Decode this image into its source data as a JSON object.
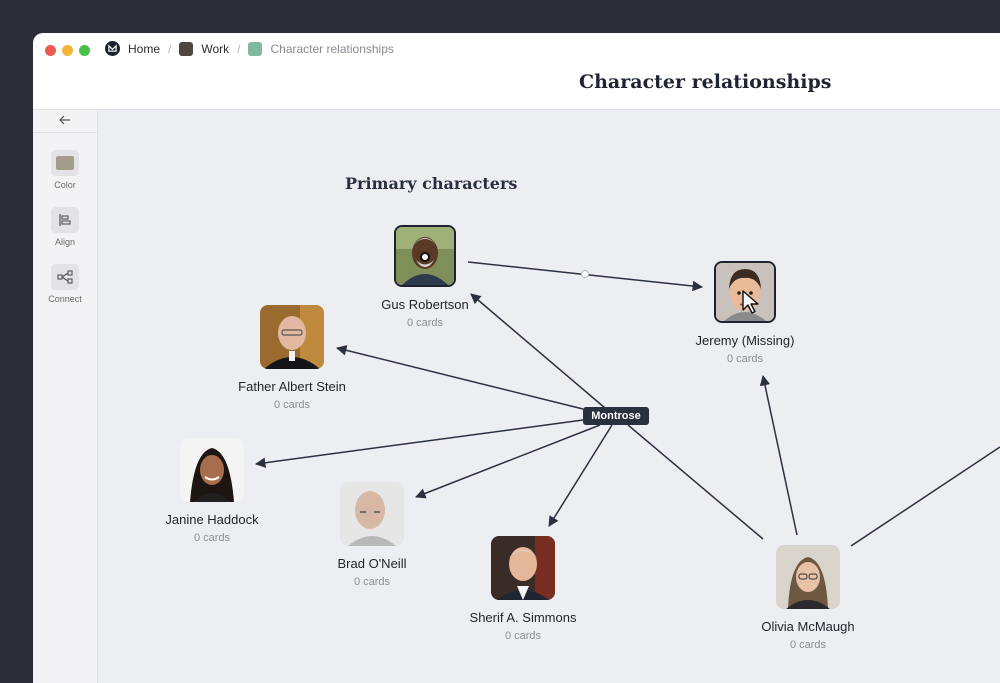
{
  "breadcrumb": {
    "home": "Home",
    "work": "Work",
    "current": "Character relationships"
  },
  "colors": {
    "work_square": "#4e4640",
    "current_square": "#7fb9a0",
    "light_red": "#ee5a52",
    "light_yellow": "#f2b43a",
    "light_green": "#46c04a"
  },
  "page_title": "Character relationships",
  "sidebar": {
    "back_icon": "arrow-left-icon",
    "tools": [
      {
        "label": "Color",
        "icon": "color-swatch-icon"
      },
      {
        "label": "Align",
        "icon": "align-left-icon"
      },
      {
        "label": "Connect",
        "icon": "connect-icon"
      }
    ]
  },
  "canvas": {
    "section_title": "Primary characters",
    "connector_label": "Montrose",
    "nodes": [
      {
        "name": "Gus Robertson",
        "cards": "0 cards"
      },
      {
        "name": "Jeremy (Missing)",
        "cards": "0 cards"
      },
      {
        "name": "Father Albert Stein",
        "cards": "0 cards"
      },
      {
        "name": "Janine Haddock",
        "cards": "0 cards"
      },
      {
        "name": "Brad O'Neill",
        "cards": "0 cards"
      },
      {
        "name": "Sherif A. Simmons",
        "cards": "0 cards"
      },
      {
        "name": "Olivia McMaugh",
        "cards": "0 cards"
      }
    ]
  }
}
